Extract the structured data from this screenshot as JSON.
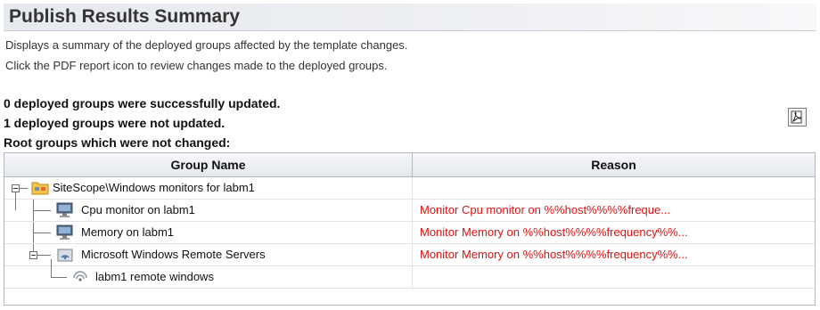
{
  "title": "Publish Results Summary",
  "description": [
    "Displays a summary of the deployed groups affected by the template changes.",
    "Click the PDF report icon to review changes made to the deployed groups."
  ],
  "stats": {
    "updated": "0 deployed groups were successfully updated.",
    "not_updated": "1 deployed groups were not updated.",
    "root_not_changed": "Root groups which were not changed:"
  },
  "icons": {
    "pdf_report": "pdf-report-icon",
    "group": "folder-group-icon",
    "monitor": "monitor-icon",
    "remote_servers": "remote-servers-icon",
    "remote": "remote-windows-icon"
  },
  "colors": {
    "reason_text": "#dd1111",
    "header_bg": "#e4e7ec"
  },
  "table": {
    "columns": [
      "Group Name",
      "Reason"
    ],
    "rows": [
      {
        "name": "SiteScope\\Windows monitors for labm1",
        "reason": ""
      },
      {
        "name": "Cpu monitor on labm1",
        "reason": "Monitor Cpu monitor on %%host%%%%freque..."
      },
      {
        "name": "Memory on labm1",
        "reason": "Monitor Memory on %%host%%%%frequency%%..."
      },
      {
        "name": "Microsoft Windows Remote Servers",
        "reason": "Monitor Memory on %%host%%%%frequency%%..."
      },
      {
        "name": "labm1 remote windows",
        "reason": ""
      }
    ]
  }
}
